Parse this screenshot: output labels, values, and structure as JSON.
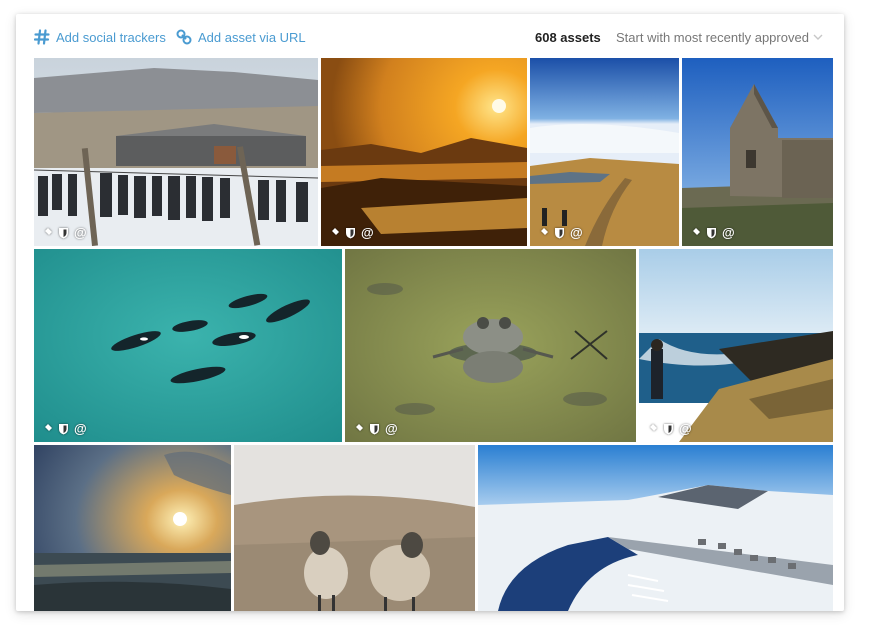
{
  "toolbar": {
    "add_social_trackers": "Add social trackers",
    "add_asset_url": "Add asset via URL",
    "asset_count": "608 assets",
    "sort_value": "Start with most recently approved"
  },
  "tile_overlay": {
    "at_symbol": "@"
  },
  "colors": {
    "accent": "#4a9bd1",
    "count_text": "#222222",
    "sort_text": "#777777"
  },
  "icons": [
    "hash-icon",
    "link-icon",
    "chevron-down-icon",
    "pin-icon",
    "shield-icon"
  ]
}
